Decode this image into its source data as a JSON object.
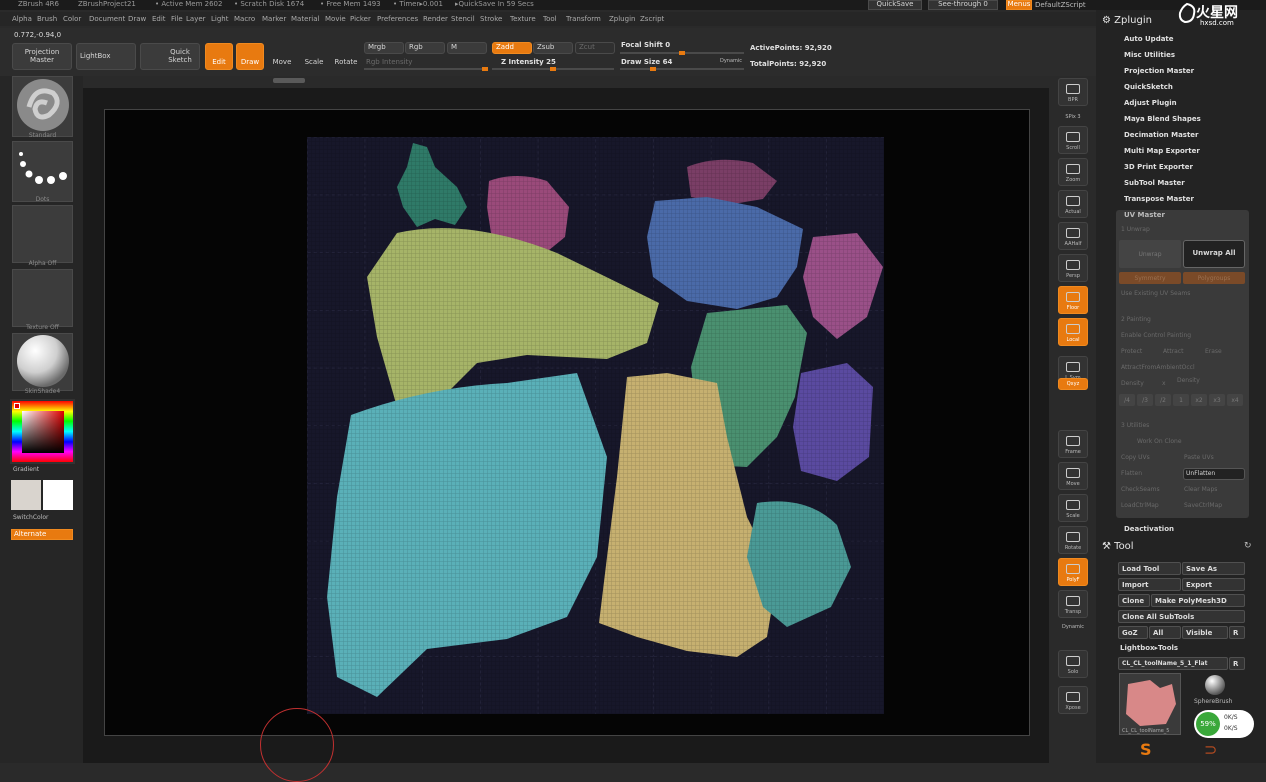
{
  "titlebar": {
    "app": "ZBrush 4R6",
    "project": "ZBrushProject21",
    "active_mem": "• Active Mem 2602",
    "scratch": "• Scratch Disk 1674",
    "free_mem": "• Free Mem 1493",
    "timer": "• Timer▸0.001",
    "quicksave_in": "▸QuickSave In 59 Secs",
    "quicksave_btn": "QuickSave",
    "see_through": "See-through  0",
    "menus": "Menus",
    "default_script": "DefaultZScript"
  },
  "menubar": [
    "Alpha",
    "Brush",
    "Color",
    "Document",
    "Draw",
    "Edit",
    "File",
    "Layer",
    "Light",
    "Macro",
    "Marker",
    "Material",
    "Movie",
    "Picker",
    "Preferences",
    "Render",
    "Stencil",
    "Stroke",
    "Texture",
    "Tool",
    "Transform",
    "Zplugin",
    "Zscript"
  ],
  "toolbar": {
    "projection_master": "Projection Master",
    "lightbox": "LightBox",
    "quick_sketch": "Quick Sketch",
    "edit": "Edit",
    "draw": "Draw",
    "move": "Move",
    "scale": "Scale",
    "rotate": "Rotate",
    "mrgb": "Mrgb",
    "rgb": "Rgb",
    "m": "M",
    "zadd": "Zadd",
    "zsub": "Zsub",
    "zcut": "Zcut",
    "rgb_intensity": "Rgb Intensity",
    "z_intensity": "Z Intensity 25",
    "focal_shift": "Focal Shift 0",
    "draw_size": "Draw Size 64",
    "dynamic": "Dynamic",
    "active_points": "ActivePoints: 92,920",
    "total_points": "TotalPoints: 92,920",
    "coords": "0.772,-0.94,0"
  },
  "leftcol": {
    "brush": "Standard",
    "stroke": "Dots",
    "alpha": "Alpha Off",
    "texture": "Texture Off",
    "material": "SkinShade4",
    "gradient": "Gradient",
    "switch_color": "SwitchColor",
    "alternate": "Alternate"
  },
  "shelf": [
    "BPR",
    "SPix 3",
    "Scroll",
    "Zoom",
    "Actual",
    "AAHalf",
    "Persp",
    "Floor",
    "Local",
    "L.Sym",
    "Qxyz",
    "Frame",
    "Move",
    "Scale",
    "Rotate",
    "PolyF",
    "Transp",
    "Dynamic",
    "Solo",
    "Xpose"
  ],
  "zplugin": {
    "title": "Zplugin",
    "items": [
      "Auto Update",
      "Misc Utilities",
      "Projection Master",
      "QuickSketch",
      "Adjust Plugin",
      "Maya Blend Shapes",
      "Decimation Master",
      "Multi Map Exporter",
      "3D Print Exporter",
      "SubTool Master",
      "Transpose Master"
    ],
    "uv_master": "UV Master",
    "unwrap_section": "1 Unwrap",
    "unwrap": "Unwrap",
    "unwrap_all": "Unwrap All",
    "symmetry": "Symmetry",
    "polygroups": "Polygroups",
    "use_existing": "Use Existing UV Seams",
    "painting_section": "2 Painting",
    "enable_cp": "Enable Control Painting",
    "protect": "Protect",
    "attract": "Attract",
    "erase": "Erase",
    "ambient": "AttractFromAmbientOccl",
    "density": "Density",
    "density_x": "x",
    "density2": "Density",
    "density_vals": [
      "/4",
      "/3",
      "/2",
      "1",
      "x2",
      "x3",
      "x4"
    ],
    "utilities_section": "3 Utilities",
    "work_on_clone": "Work On Clone",
    "copy_uvs": "Copy UVs",
    "paste_uvs": "Paste UVs",
    "flatten": "Flatten",
    "unflatten": "UnFlatten",
    "check_seams": "CheckSeams",
    "clear_maps": "Clear Maps",
    "load_ctrl": "LoadCtrlMap",
    "save_ctrl": "SaveCtrlMap",
    "deactivation": "Deactivation"
  },
  "tool": {
    "title": "Tool",
    "load_tool": "Load Tool",
    "save_as": "Save As",
    "import": "Import",
    "export": "Export",
    "clone": "Clone",
    "make_polymesh": "Make PolyMesh3D",
    "clone_all": "Clone All SubTools",
    "goz": "GoZ",
    "all": "All",
    "visible": "Visible",
    "r": "R",
    "lightbox_tools": "Lightbox▸Tools",
    "tool_name": "CL_CL_toolName_5_1_Flat",
    "tool_thumb": "CL_CL_toolName_5",
    "sphere_brush": "SphereBrush",
    "net_pct": "59%",
    "net_up": "0K/S",
    "net_down": "0K/S"
  },
  "watermark": {
    "text": "火星网",
    "sub": "hxsd.com"
  },
  "colors": {
    "accent": "#e87a10",
    "panel": "#232323",
    "viewport": "#1a1a1a",
    "uv_background": "#17172a"
  }
}
